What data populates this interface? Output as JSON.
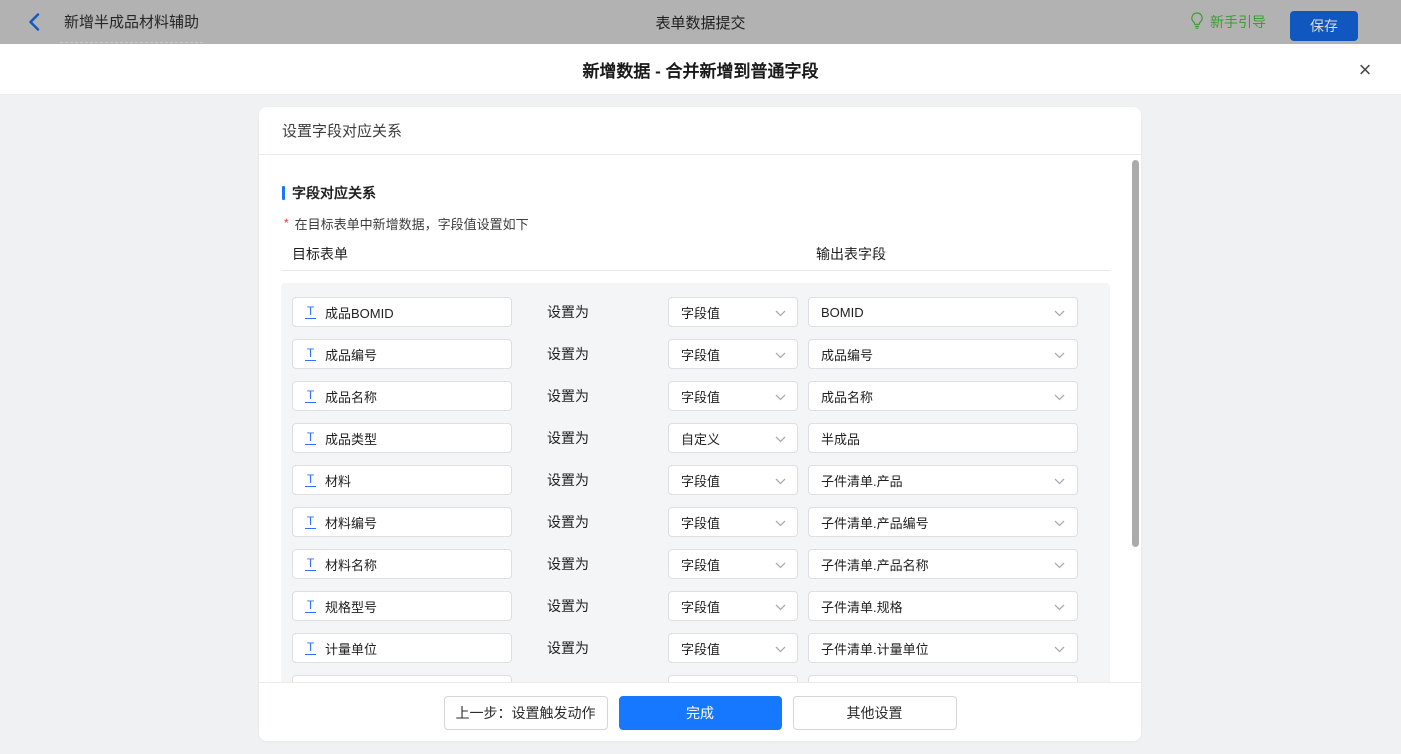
{
  "topbar": {
    "back_title": "新增半成品材料辅助",
    "center_title": "表单数据提交",
    "guide_label": "新手引导",
    "save_label": "保存"
  },
  "modal": {
    "title": "新增数据 - 合并新增到普通字段",
    "close_glyph": "×"
  },
  "card": {
    "header": "设置字段对应关系",
    "section_title": "字段对应关系",
    "required_mark": "*",
    "hint": "在目标表单中新增数据，字段值设置如下",
    "col_left": "目标表单",
    "col_right": "输出表字段",
    "middle_label": "设置为",
    "rows": [
      {
        "field": "成品BOMID",
        "mode": "字段值",
        "value": "BOMID",
        "value_dropdown": true,
        "partial": false
      },
      {
        "field": "成品编号",
        "mode": "字段值",
        "value": "成品编号",
        "value_dropdown": true,
        "partial": false
      },
      {
        "field": "成品名称",
        "mode": "字段值",
        "value": "成品名称",
        "value_dropdown": true,
        "partial": false
      },
      {
        "field": "成品类型",
        "mode": "自定义",
        "value": "半成品",
        "value_dropdown": false,
        "partial": false
      },
      {
        "field": "材料",
        "mode": "字段值",
        "value": "子件清单.产品",
        "value_dropdown": true,
        "partial": false
      },
      {
        "field": "材料编号",
        "mode": "字段值",
        "value": "子件清单.产品编号",
        "value_dropdown": true,
        "partial": false
      },
      {
        "field": "材料名称",
        "mode": "字段值",
        "value": "子件清单.产品名称",
        "value_dropdown": true,
        "partial": false
      },
      {
        "field": "规格型号",
        "mode": "字段值",
        "value": "子件清单.规格",
        "value_dropdown": true,
        "partial": false
      },
      {
        "field": "计量单位",
        "mode": "字段值",
        "value": "子件清单.计量单位",
        "value_dropdown": true,
        "partial": false
      },
      {
        "field": "",
        "mode": "",
        "value": "",
        "value_dropdown": false,
        "partial": true
      }
    ],
    "footer": {
      "prev_label": "上一步：设置触发动作",
      "done_label": "完成",
      "other_label": "其他设置"
    }
  },
  "colors": {
    "accent_blue": "#1678ff",
    "guide_green": "#3e9b36",
    "topbar_dimmed_bg": "#b2b2b2",
    "panel_bg": "#f4f5f7"
  }
}
